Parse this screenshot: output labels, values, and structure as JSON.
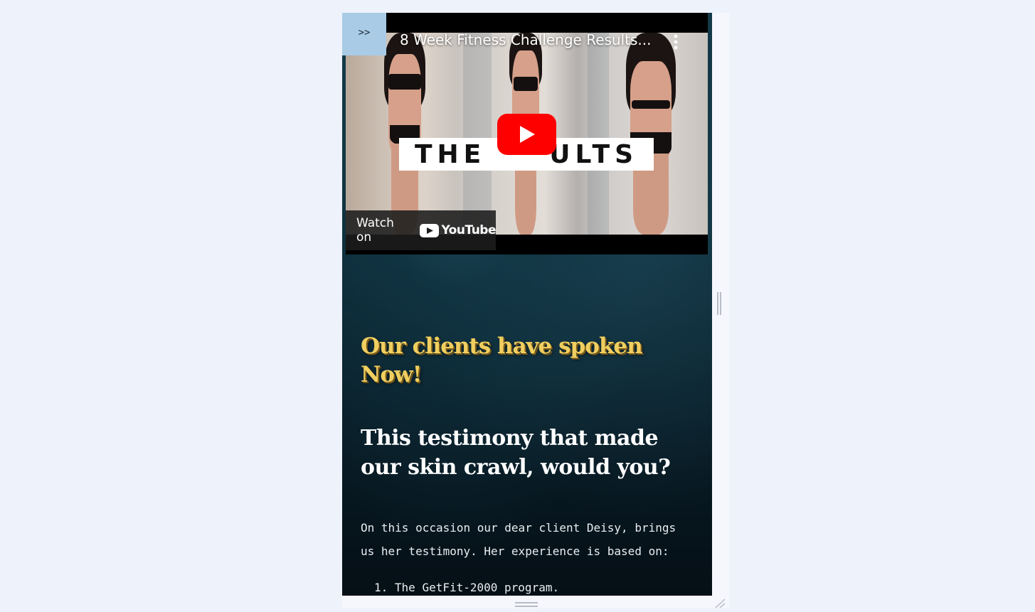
{
  "sidebar_toggle": {
    "label": ">>"
  },
  "video": {
    "title": "8 Week Fitness Challenge Results...",
    "thumbnail_text_left": "THE",
    "thumbnail_text_right": "ULTS",
    "watch_on_label": "Watch on",
    "youtube_wordmark": "YouTube",
    "menu_icon": "more-vert-icon",
    "play_icon": "play-icon"
  },
  "section": {
    "heading": "Our clients have spoken Now!",
    "subheading": "This testimony that made our skin crawl, would you?",
    "intro": "On this occasion our dear client Deisy, brings us her testimony. Her experience is based on:",
    "list": [
      {
        "number": "1.",
        "text": "The GetFit-2000 program."
      }
    ]
  },
  "colors": {
    "heading_gold": "#f0cf60",
    "toggle_bg": "#a9cbe6",
    "youtube_red": "#ff0000",
    "page_bg": "#eef2fb"
  }
}
